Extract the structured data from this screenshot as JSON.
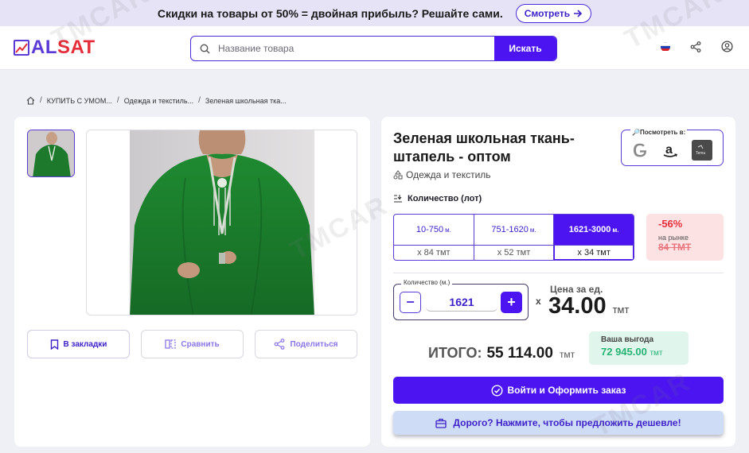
{
  "promo": {
    "text": "Скидки на товары от 50% = двойная прибыль? Решайте сами.",
    "button": "Смотреть"
  },
  "header": {
    "logo_a": "AL",
    "logo_sat": "SAT",
    "search_placeholder": "Название товара",
    "search_button": "Искать",
    "icons": [
      "flag-icon",
      "share-icon",
      "account-icon"
    ]
  },
  "breadcrumb": {
    "items": [
      "КУПИТЬ С УМОМ...",
      "Одежда и текстиль...",
      "Зеленая школьная тка..."
    ]
  },
  "gallery": {
    "actions": {
      "bookmark": "В закладки",
      "compare": "Сравнить",
      "share": "Поделиться"
    }
  },
  "product": {
    "title": "Зеленая школьная ткань-штапель - оптом",
    "category": "Одежда и текстиль",
    "lookup_label": "🔎Посмотреть в:",
    "lookup_icons": [
      "google-icon",
      "amazon-icon",
      "temu-icon"
    ],
    "qty_lot_label": "Количество (лот)",
    "tiers": [
      {
        "range": "10-750",
        "unit": "м.",
        "price": "x 84 тмт"
      },
      {
        "range": "751-1620",
        "unit": "м.",
        "price": "x 52 тмт"
      },
      {
        "range": "1621-3000",
        "unit": "м.",
        "price": "x 34 тмт"
      }
    ],
    "discount": {
      "percent": "-56%",
      "market_label": "на рынке",
      "market_price": "84 ТМТ"
    },
    "stepper": {
      "label": "Количество (м.)",
      "value": "1621",
      "minus": "−",
      "plus": "+"
    },
    "times": "x",
    "unit_price_label": "Цена за ед.",
    "unit_price": "34.00",
    "currency": "тмт",
    "total_label": "ИТОГО:",
    "total_value": "55 114.00",
    "benefit_label": "Ваша выгода",
    "benefit_value": "72 945.00",
    "order_button": "Войти и Оформить заказ",
    "offer_button": "Дорого? Нажмите, чтобы предложить дешевле!"
  },
  "watermark": "TMCAR",
  "colors": {
    "accent": "#4b14f0",
    "brand_red": "#e42f3b",
    "benefit_green": "#25b374",
    "dress_green": "#1d7a2c"
  }
}
